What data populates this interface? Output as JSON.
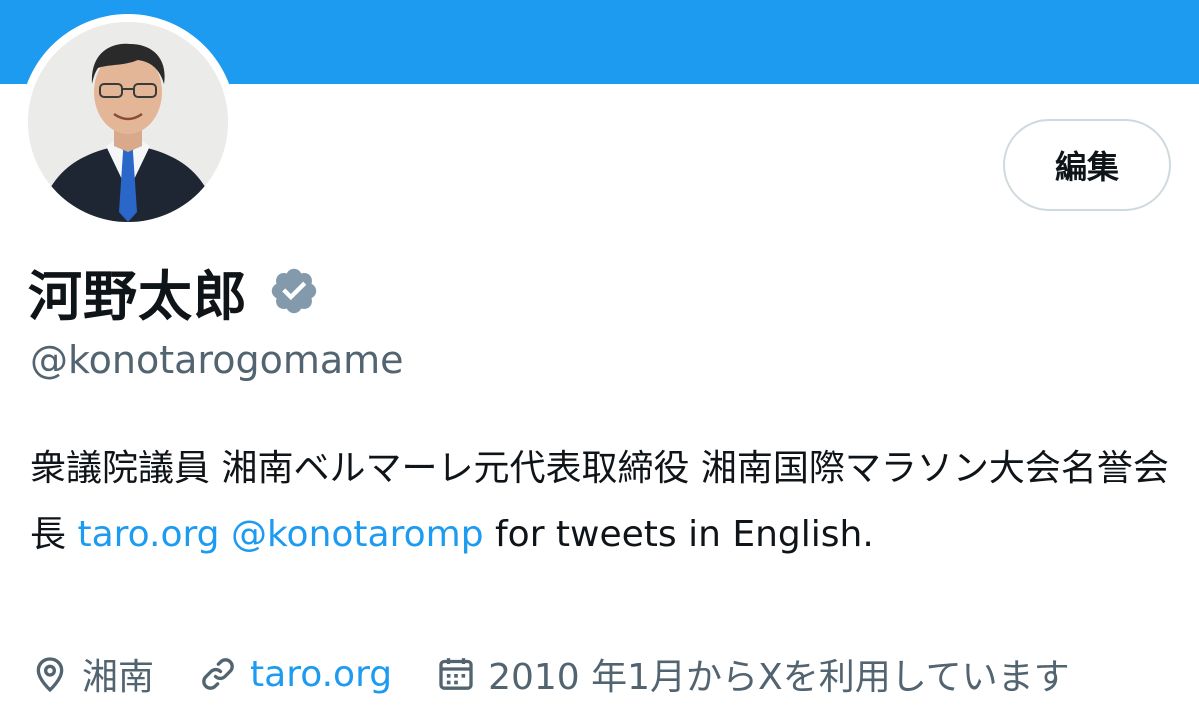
{
  "colors": {
    "banner": "#1d9bf0",
    "link": "#1d9bf0",
    "secondary_text": "#536471",
    "verified_badge": "#829aab"
  },
  "profile": {
    "edit_label": "編集",
    "display_name": "河野太郎",
    "verified_icon": "verified-badge-icon",
    "handle": "@konotarogomame",
    "bio": {
      "text_1": "衆議院議員 湘南ベルマーレ元代表取締役 湘南国際マラソン大会名誉会長 ",
      "link_1": "taro.org",
      "space_1": " ",
      "mention": "@konotaromp",
      "text_2": " for tweets in English."
    },
    "meta": {
      "location_icon": "location-pin-icon",
      "location": "湘南",
      "website_icon": "link-icon",
      "website": "taro.org",
      "joined_icon": "calendar-icon",
      "joined": "2010 年1月からXを利用しています"
    }
  }
}
